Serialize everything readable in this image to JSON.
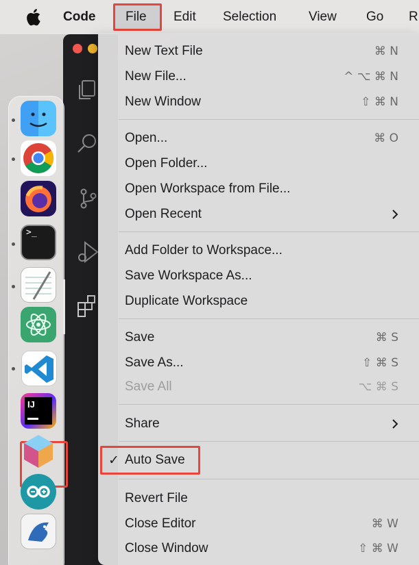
{
  "menubar": {
    "apple_icon": "apple-logo-icon",
    "app_name": "Code",
    "items": [
      "File",
      "Edit",
      "Selection",
      "View",
      "Go",
      "R"
    ],
    "accent_highlight": "#e5453a"
  },
  "dock": {
    "apps": [
      {
        "name": "Finder",
        "icon": "finder-icon",
        "running": true
      },
      {
        "name": "Chrome",
        "icon": "chrome-icon",
        "running": true
      },
      {
        "name": "Firefox",
        "icon": "firefox-icon",
        "running": false
      },
      {
        "name": "Terminal",
        "icon": "terminal-icon",
        "running": true,
        "glyph": ">_"
      },
      {
        "name": "TextEdit",
        "icon": "textedit-icon",
        "running": true
      },
      {
        "name": "Atom",
        "icon": "atom-icon",
        "running": false
      },
      {
        "name": "Visual Studio Code",
        "icon": "vscode-icon",
        "running": true
      },
      {
        "name": "IntelliJ IDEA",
        "icon": "intellij-icon",
        "running": false,
        "glyph": "IJ"
      },
      {
        "name": "NetBeans",
        "icon": "netbeans-icon",
        "running": false
      },
      {
        "name": "Arduino",
        "icon": "arduino-icon",
        "running": false
      },
      {
        "name": "BlueJ",
        "icon": "bluej-icon",
        "running": false
      }
    ]
  },
  "file_menu": {
    "groups": [
      [
        {
          "label": "New Text File",
          "shortcut": "⌘ N"
        },
        {
          "label": "New File...",
          "shortcut": "^ ⌥ ⌘ N"
        },
        {
          "label": "New Window",
          "shortcut": "⇧ ⌘ N"
        }
      ],
      [
        {
          "label": "Open...",
          "shortcut": "⌘ O"
        },
        {
          "label": "Open Folder...",
          "shortcut": ""
        },
        {
          "label": "Open Workspace from File...",
          "shortcut": ""
        },
        {
          "label": "Open Recent",
          "shortcut": "",
          "submenu": true
        }
      ],
      [
        {
          "label": "Add Folder to Workspace...",
          "shortcut": ""
        },
        {
          "label": "Save Workspace As...",
          "shortcut": ""
        },
        {
          "label": "Duplicate Workspace",
          "shortcut": ""
        }
      ],
      [
        {
          "label": "Save",
          "shortcut": "⌘ S"
        },
        {
          "label": "Save As...",
          "shortcut": "⇧ ⌘ S"
        },
        {
          "label": "Save All",
          "shortcut": "⌥ ⌘ S",
          "disabled": true
        }
      ],
      [
        {
          "label": "Share",
          "shortcut": "",
          "submenu": true
        }
      ],
      [
        {
          "label": "Auto Save",
          "shortcut": "",
          "checked": true,
          "check_mark": "✓"
        }
      ],
      [
        {
          "label": "Revert File",
          "shortcut": ""
        },
        {
          "label": "Close Editor",
          "shortcut": "⌘ W"
        },
        {
          "label": "Close Window",
          "shortcut": "⇧ ⌘ W"
        }
      ]
    ]
  }
}
